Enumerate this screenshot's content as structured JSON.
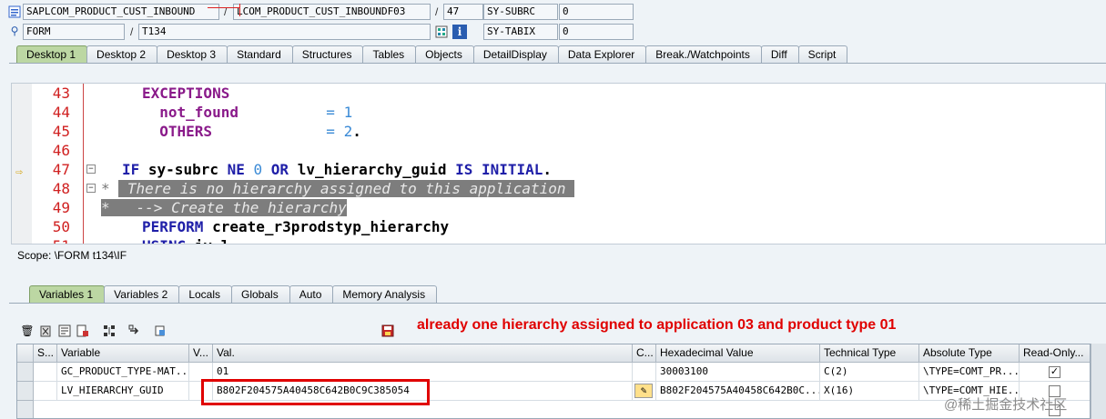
{
  "header": {
    "program": "SAPLCOM_PRODUCT_CUST_INBOUND",
    "include": "LCOM_PRODUCT_CUST_INBOUNDF03",
    "line": "47",
    "sys_field_1": "SY-SUBRC",
    "sys_value_1": "0",
    "event_type": "FORM",
    "event_name": "T134",
    "sys_field_2": "SY-TABIX",
    "sys_value_2": "0",
    "slash": "/"
  },
  "main_tabs": [
    "Desktop 1",
    "Desktop 2",
    "Desktop 3",
    "Standard",
    "Structures",
    "Tables",
    "Objects",
    "DetailDisplay",
    "Data Explorer",
    "Break./Watchpoints",
    "Diff",
    "Script"
  ],
  "code": {
    "lines": [
      {
        "num": "43",
        "parts": [
          {
            "t": "EXCEPTIONS",
            "c": "kwm"
          }
        ]
      },
      {
        "num": "44",
        "parts": [
          {
            "t": "  not_found",
            "c": "kwm"
          },
          {
            "t": "          = ",
            "c": "nm"
          },
          {
            "t": "1",
            "c": "nm"
          }
        ]
      },
      {
        "num": "45",
        "parts": [
          {
            "t": "  OTHERS",
            "c": "kwm"
          },
          {
            "t": "             = ",
            "c": "nm"
          },
          {
            "t": "2",
            "c": "nm"
          },
          {
            "t": ".",
            "c": "idn"
          }
        ]
      },
      {
        "num": "46",
        "parts": []
      },
      {
        "num": "47",
        "parts": [
          {
            "t": "IF ",
            "c": "kw"
          },
          {
            "t": "sy-subrc ",
            "c": "idn"
          },
          {
            "t": "NE ",
            "c": "kw"
          },
          {
            "t": "0 ",
            "c": "nm"
          },
          {
            "t": "OR ",
            "c": "kw"
          },
          {
            "t": "lv_hierarchy_guid ",
            "c": "idn"
          },
          {
            "t": "IS INITIAL",
            "c": "kw"
          },
          {
            "t": ".",
            "c": "idn"
          }
        ]
      },
      {
        "num": "48",
        "parts": [
          {
            "t": "* ",
            "c": "cmtstar"
          },
          {
            "t": " There is no hierarchy assigned to this application ",
            "c": "cmt"
          }
        ]
      },
      {
        "num": "49",
        "parts": [
          {
            "t": "*   --> Create the hierarchy",
            "c": "cmt"
          }
        ]
      },
      {
        "num": "50",
        "parts": [
          {
            "t": "PERFORM ",
            "c": "kw"
          },
          {
            "t": "create_r3prodstyp_hierarchy",
            "c": "idn"
          }
        ]
      },
      {
        "num": "51",
        "parts": [
          {
            "t": "USING ",
            "c": "kw"
          },
          {
            "t": "iv_l",
            "c": "idn"
          }
        ]
      }
    ]
  },
  "scope": "Scope: \\FORM t134\\IF",
  "var_tabs": [
    "Variables 1",
    "Variables 2",
    "Locals",
    "Globals",
    "Auto",
    "Memory Analysis"
  ],
  "annotation": "already one hierarchy assigned to application 03 and product type 01",
  "grid": {
    "headers": [
      "S...",
      "Variable",
      "V...",
      "Val.",
      "C...",
      "Hexadecimal Value",
      "Technical Type",
      "Absolute Type",
      "Read-Only..."
    ],
    "rows": [
      {
        "variable": "GC_PRODUCT_TYPE-MAT...",
        "value": "01",
        "hex": "30003100",
        "tech": "C(2)",
        "abs": "\\TYPE=COMT_PR...",
        "readonly": true
      },
      {
        "variable": "LV_HIERARCHY_GUID",
        "value": "B802F204575A40458C642B0C9C385054",
        "hex": "B802F204575A40458C642B0C...",
        "tech": "X(16)",
        "abs": "\\TYPE=COMT_HIE...",
        "readonly": false
      }
    ]
  },
  "watermark": "@稀土掘金技术社区",
  "colors": {
    "active_tab": "#bcd7a3",
    "annotation": "#e00000",
    "line_number": "#d02020"
  }
}
